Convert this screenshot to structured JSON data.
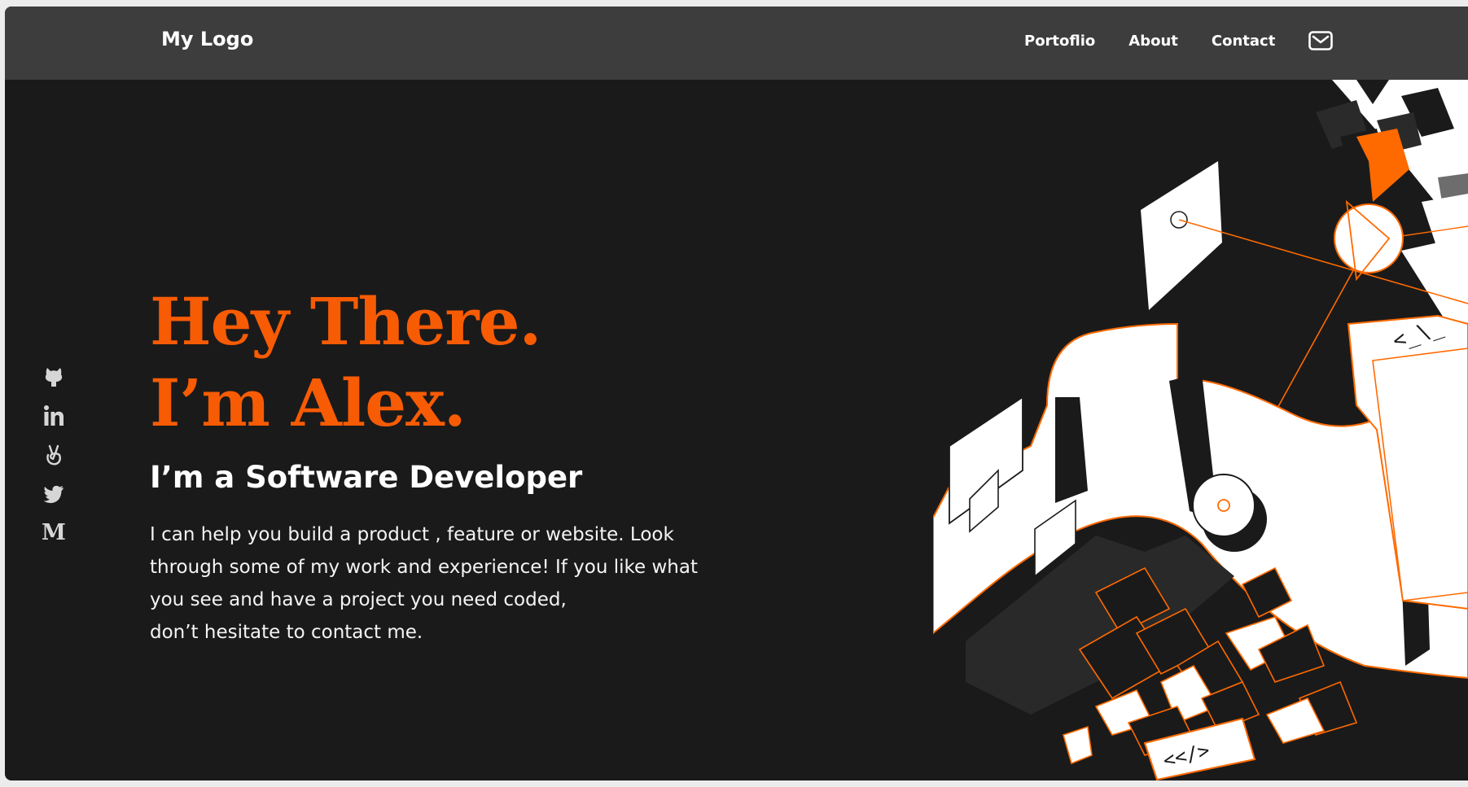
{
  "header": {
    "logo": "My Logo",
    "nav": [
      {
        "label": "Portoflio"
      },
      {
        "label": "About"
      },
      {
        "label": "Contact"
      }
    ],
    "mail_icon": "mail-icon"
  },
  "social": [
    {
      "icon": "github-icon"
    },
    {
      "icon": "linkedin-icon"
    },
    {
      "icon": "angellist-icon"
    },
    {
      "icon": "twitter-icon"
    },
    {
      "icon": "medium-icon",
      "glyph": "M"
    }
  ],
  "hero": {
    "headline_line1": "Hey There.",
    "headline_line2": "I’m Alex.",
    "subtitle": "I’m a Software Developer",
    "description_lines": [
      "I can help you build a product , feature or website. Look",
      "through some of my work and experience! If you like what",
      "you see and have a project you need coded,",
      "don’t hesitate to contact me."
    ]
  },
  "illustration": {
    "code_tag_1": "<_\\_",
    "code_tag_2": "<</>"
  },
  "colors": {
    "accent": "#f75b04",
    "background": "#1b1a1a",
    "navbar": "#3e3d3e",
    "text": "#ffffff"
  }
}
